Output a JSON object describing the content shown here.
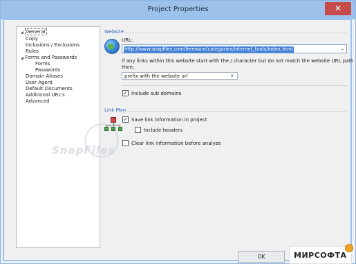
{
  "window": {
    "title": "Project Properties",
    "close_glyph": "✕"
  },
  "tree": {
    "items": [
      {
        "label": "General",
        "level": 0,
        "expander": "◢",
        "selected": true
      },
      {
        "label": "Copy",
        "level": 1
      },
      {
        "label": "Inclusions / Exclusions",
        "level": 1
      },
      {
        "label": "Rules",
        "level": 1
      },
      {
        "label": "Forms and Passwords",
        "level": 1,
        "expander": "◢"
      },
      {
        "label": "Forms",
        "level": 2
      },
      {
        "label": "Passwords",
        "level": 2
      },
      {
        "label": "Domain Aliases",
        "level": 1
      },
      {
        "label": "User Agent",
        "level": 1
      },
      {
        "label": "Default Documents",
        "level": 1
      },
      {
        "label": "Additional URL's",
        "level": 1
      },
      {
        "label": "Advanced",
        "level": 1
      }
    ]
  },
  "website": {
    "section_label": "Website",
    "url_label": "URL:",
    "url_value": "http://www.snapfiles.com/freeware/categories/internet_tools/index.html",
    "links_text_line1": "If any links within this website start with the / character but do not match the website URL path",
    "links_text_line2": "then:",
    "prefix_select_value": "prefix with the website url",
    "include_subdomains_label": "Include sub domains",
    "include_subdomains_checked": true
  },
  "link_map": {
    "section_label": "Link Map",
    "save_link_info_label": "Save link information in project",
    "save_link_info_checked": true,
    "include_headers_label": "Include headers",
    "include_headers_checked": false,
    "clear_link_info_label": "Clear link information before analyze",
    "clear_link_info_checked": false
  },
  "buttons": {
    "ok_label": "OK"
  },
  "watermark": {
    "text": "SnapFiles"
  },
  "logo": {
    "text": "МИРСОФТА"
  },
  "icons": {
    "website": "globe-icon",
    "link_map": "sitemap-icon",
    "check": "✓",
    "dropdown": "⌄",
    "select_dropdown": "∨"
  },
  "colors": {
    "titlebar": "#9cc2ec",
    "close": "#c74b4b",
    "section": "#2a68c0",
    "selection": "#3f7fd6"
  }
}
